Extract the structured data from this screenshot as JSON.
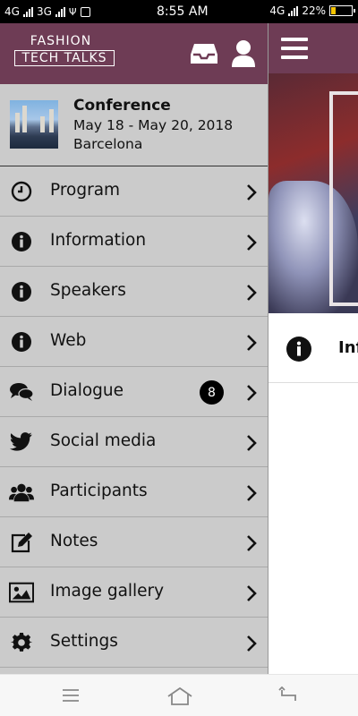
{
  "status_bar": {
    "net1": "4G",
    "net2": "3G",
    "time": "8:55 AM",
    "net3": "4G",
    "battery": "22%",
    "battery_level": 0.22
  },
  "drawer": {
    "logo": {
      "line1": "FASHION",
      "line2": "TECH TALKS"
    },
    "event": {
      "title": "Conference",
      "dates": "May 18 - May 20, 2018",
      "city": "Barcelona"
    },
    "items": [
      {
        "label": "Program",
        "icon": "clock-icon"
      },
      {
        "label": "Information",
        "icon": "info-icon"
      },
      {
        "label": "Speakers",
        "icon": "info-icon"
      },
      {
        "label": "Web",
        "icon": "info-icon"
      },
      {
        "label": "Dialogue",
        "icon": "chat-icon",
        "badge": "8"
      },
      {
        "label": "Social media",
        "icon": "twitter-icon"
      },
      {
        "label": "Participants",
        "icon": "people-icon"
      },
      {
        "label": "Notes",
        "icon": "edit-icon"
      },
      {
        "label": "Image gallery",
        "icon": "image-icon"
      },
      {
        "label": "Settings",
        "icon": "gear-icon"
      }
    ]
  },
  "content": {
    "visible_row_text": "Inf"
  },
  "colors": {
    "brand": "#6e3c55",
    "drawer_bg": "#cbcbcb"
  }
}
